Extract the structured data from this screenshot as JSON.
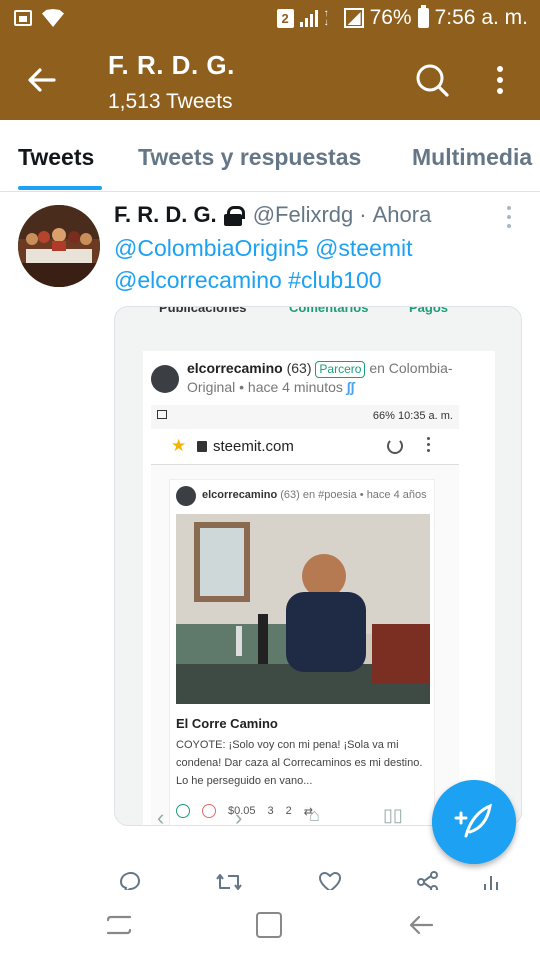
{
  "status_bar": {
    "sim_badge": "2",
    "battery": "76%",
    "time": "7:56 a. m."
  },
  "header": {
    "title": "F. R. D. G.",
    "subtitle": "1,513 Tweets"
  },
  "tabs": [
    "Tweets",
    "Tweets y respuestas",
    "Multimedia"
  ],
  "tweet": {
    "name": "F. R. D. G.",
    "handle": "@Felixrdg",
    "separator": "·",
    "time": "Ahora",
    "lines": [
      "@ColombiaOrigin5 @steemit",
      "@elcorrecamino #club100"
    ]
  },
  "embedded": {
    "top_tabs": [
      "Publicaciones",
      "Comentarios",
      "Pagos"
    ],
    "author": "elcorrecamino",
    "reputation": "(63)",
    "badge": "Parcero",
    "community": "en Colombia-Original",
    "time": "• hace 4 minutos",
    "inner_status": {
      "battery": "66%",
      "time": "10:35 a. m."
    },
    "url": "steemit.com",
    "post": {
      "author": "elcorrecamino",
      "reputation": "(63)",
      "community": "en #poesia",
      "time": "• hace 4 años",
      "title": "El Corre Camino",
      "body": "COYOTE: ¡Solo voy con mi pena! ¡Sola va mi condena! Dar caza al Correcaminos es mi destino. Lo he perseguido en vano...",
      "payout": "$0.05",
      "votes": "3",
      "comments": "2"
    }
  },
  "colors": {
    "header_bg": "#8e5f1d",
    "accent": "#1da1f2",
    "steemit_green": "#1a9e7a"
  }
}
